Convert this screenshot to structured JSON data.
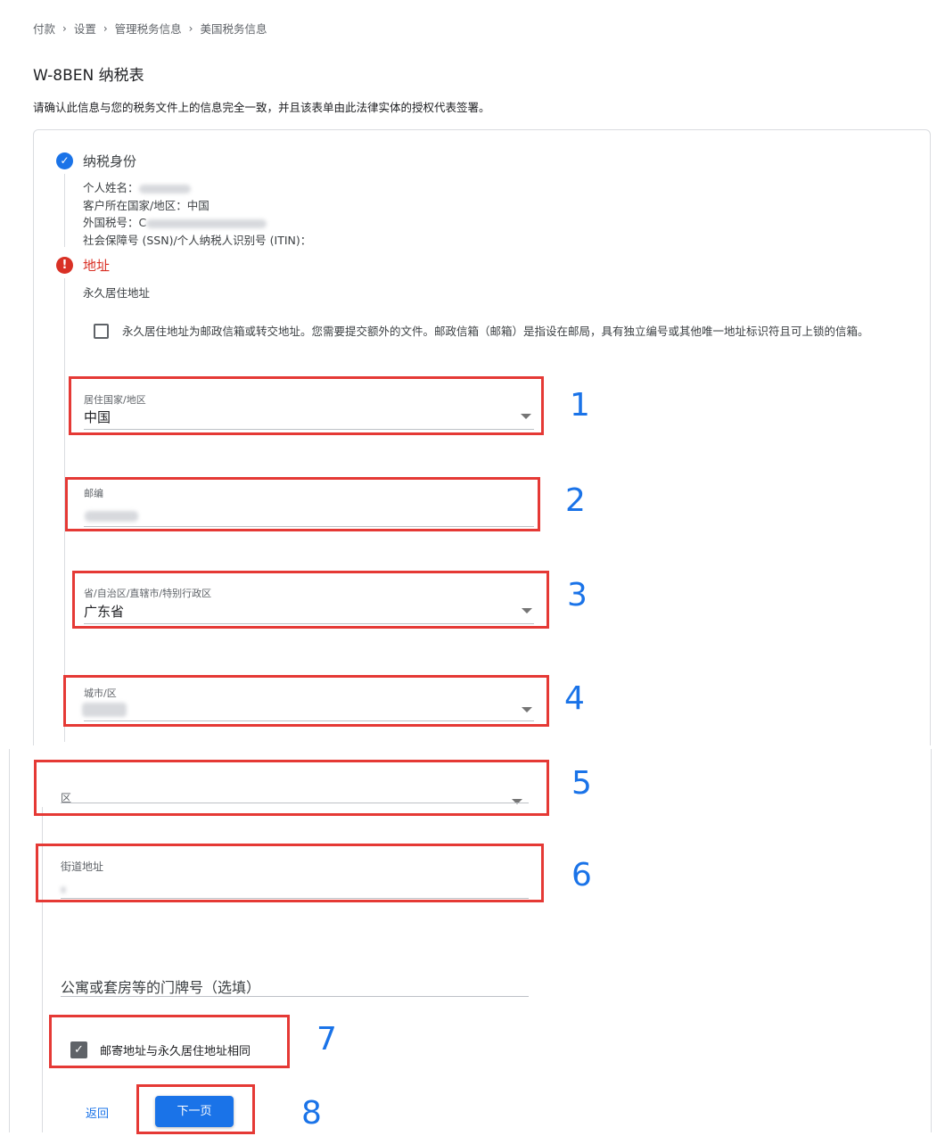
{
  "breadcrumb": [
    "付款",
    "设置",
    "管理税务信息",
    "美国税务信息"
  ],
  "breadcrumb_separator": "›",
  "page": {
    "title": "W-8BEN 纳税表",
    "description": "请确认此信息与您的税务文件上的信息完全一致，并且该表单由此法律实体的授权代表签署。"
  },
  "tax_identity": {
    "label": "纳税身份",
    "name_label": "个人姓名：",
    "country_line": "客户所在国家/地区：中国",
    "foreign_tax_label": "外国税号：",
    "foreign_tax_visible": "C",
    "ssn_label": "社会保障号 (SSN)/个人纳税人识别号 (ITIN)："
  },
  "address": {
    "label": "地址",
    "sublabel": "永久居住地址",
    "po_box_text": "永久居住地址为邮政信箱或转交地址。您需要提交额外的文件。邮政信箱（邮箱）是指设在邮局，具有独立编号或其他唯一地址标识符且可上锁的信箱。",
    "country_label": "居住国家/地区",
    "country_value": "中国",
    "postal_label": "邮编",
    "province_label": "省/自治区/直辖市/特别行政区",
    "province_value": "广东省",
    "city_label": "城市/区",
    "district_label": "区",
    "street_label": "街道地址",
    "apartment_label": "公寓或套房等的门牌号（选填）",
    "mailing_same_label": "邮寄地址与永久居住地址相同",
    "mailing_same_checked": true
  },
  "actions": {
    "back_label": "返回",
    "next_label": "下一页"
  },
  "annotations": [
    "1",
    "2",
    "3",
    "4",
    "5",
    "6",
    "7",
    "8"
  ],
  "colors": {
    "accent": "#1a73e8",
    "error": "#d93025",
    "annotation_box": "#e53935"
  }
}
